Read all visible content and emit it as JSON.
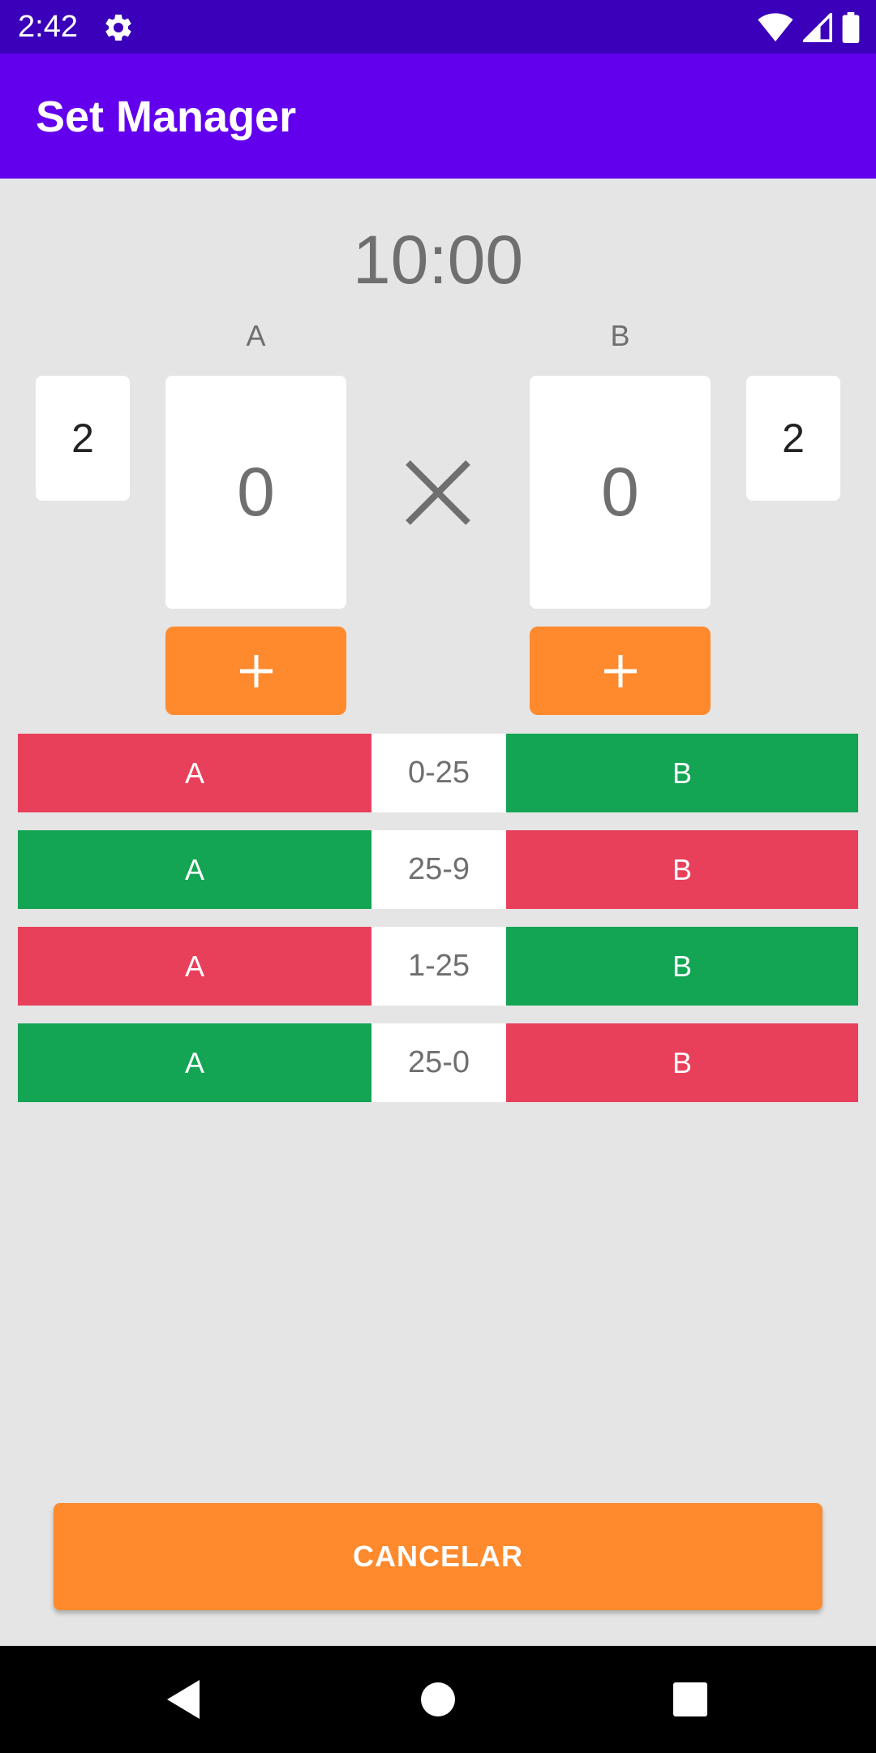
{
  "status_bar": {
    "time": "2:42",
    "icons": [
      "gear-icon",
      "wifi-icon",
      "signal-icon",
      "battery-icon"
    ]
  },
  "app_bar": {
    "title": "Set Manager"
  },
  "match": {
    "timer": "10:00",
    "team_a": {
      "label": "A",
      "sets_won": "2",
      "points": "0"
    },
    "team_b": {
      "label": "B",
      "sets_won": "2",
      "points": "0"
    },
    "versus_icon": "close-icon",
    "add_point_icon": "plus-icon"
  },
  "sets": [
    {
      "team_a": "A",
      "score_a": "0",
      "separator": "-",
      "score_b": "25",
      "team_b": "B",
      "winner": "B"
    },
    {
      "team_a": "A",
      "score_a": "25",
      "separator": "-",
      "score_b": "9",
      "team_b": "B",
      "winner": "A"
    },
    {
      "team_a": "A",
      "score_a": "1",
      "separator": "-",
      "score_b": "25",
      "team_b": "B",
      "winner": "B"
    },
    {
      "team_a": "A",
      "score_a": "25",
      "separator": "-",
      "score_b": "0",
      "team_b": "B",
      "winner": "A"
    }
  ],
  "cancel_label": "CANCELAR",
  "colors": {
    "status_bar": "#3b00b9",
    "app_bar": "#6200ee",
    "accent": "#ff8a2e",
    "winner": "#13a454",
    "loser": "#e8405b",
    "background": "#e5e5e5"
  },
  "nav_bar": {
    "icons": [
      "back-icon",
      "home-icon",
      "recents-icon"
    ]
  }
}
